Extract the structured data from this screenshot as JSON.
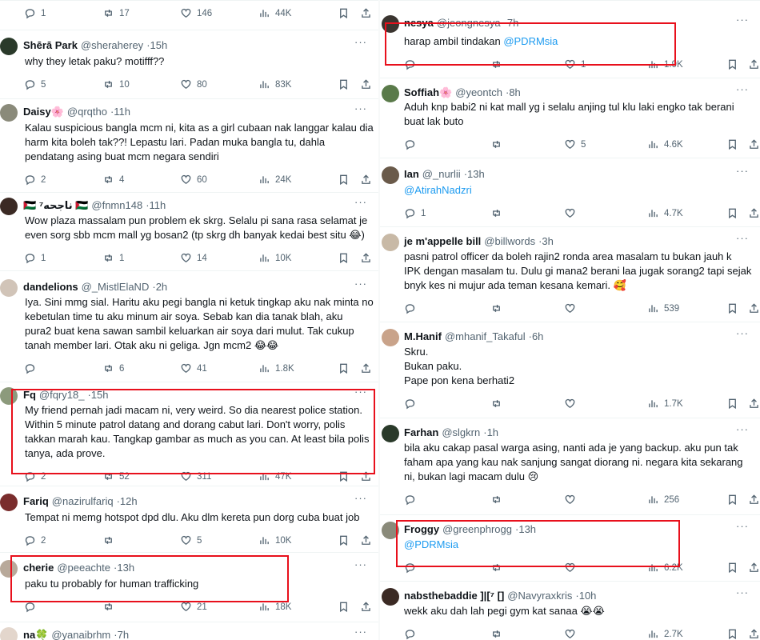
{
  "left": [
    {
      "name": "",
      "handle": "",
      "time": "",
      "lines": [],
      "replies": "1",
      "reposts": "17",
      "likes": "146",
      "views": "44K"
    },
    {
      "name": "Shērā Park",
      "handle": "@sheraherey",
      "time": "15h",
      "lines": [
        "why they letak paku? motifff??"
      ],
      "replies": "5",
      "reposts": "10",
      "likes": "80",
      "views": "83K"
    },
    {
      "name": "Daisy🌸",
      "handle": "@qrqtho",
      "time": "11h",
      "lines": [
        "Kalau suspicious bangla mcm ni, kita as a girl cubaan nak langgar kalau dia",
        "harm kita boleh tak??! Lepastu lari. Padan muka bangla tu, dahla",
        "pendatang asing buat mcm negara sendiri"
      ],
      "replies": "2",
      "reposts": "4",
      "likes": "60",
      "views": "24K"
    },
    {
      "name": "🇵🇸 ناجحه⁷ 🇵🇸",
      "handle": "@fnmn148",
      "time": "11h",
      "lines": [
        "Wow plaza massalam pun problem ek skrg. Selalu pi sana rasa selamat je",
        "even sorg sbb mcm mall yg bosan2 (tp skrg dh banyak kedai best situ 😂)"
      ],
      "replies": "1",
      "reposts": "1",
      "likes": "14",
      "views": "10K"
    },
    {
      "name": "dandelions",
      "handle": "@_MistlElaND",
      "time": "2h",
      "lines": [
        "Iya. Sini mmg sial. Haritu aku pegi bangla ni ketuk tingkap aku nak minta no",
        "kebetulan time tu aku minum air soya. Sebab kan dia tanak blah, aku",
        "pura2 buat kena sawan sambil keluarkan air soya dari mulut. Tak cukup",
        "tanah member lari. Otak aku ni geliga. Jgn mcm2 😂😂"
      ],
      "replies": "",
      "reposts": "6",
      "likes": "41",
      "views": "1.8K"
    },
    {
      "name": "Fq",
      "handle": "@fqry18_",
      "time": "15h",
      "lines": [
        "My friend pernah jadi macam ni, very weird. So dia nearest police station.",
        "Within 5 minute patrol datang and dorang cabut lari.  Don't worry, polis",
        "takkan marah kau. Tangkap gambar as much as you can. At least bila polis",
        "tanya, ada prove."
      ],
      "replies": "2",
      "reposts": "52",
      "likes": "311",
      "views": "47K"
    },
    {
      "name": "Fariq",
      "handle": "@nazirulfariq",
      "time": "12h",
      "lines": [
        "Tempat ni memg hotspot dpd dlu. Aku dlm kereta pun dorg cuba buat job"
      ],
      "replies": "2",
      "reposts": "",
      "likes": "5",
      "views": "10K"
    },
    {
      "name": "cherie",
      "handle": "@peeachte",
      "time": "13h",
      "lines": [
        "paku tu probably for human trafficking"
      ],
      "replies": "",
      "reposts": "",
      "likes": "21",
      "views": "18K"
    },
    {
      "name": "na🍀",
      "handle": "@yanaibrhm",
      "time": "7h",
      "lines": [],
      "replies": "",
      "reposts": "",
      "likes": "",
      "views": ""
    }
  ],
  "right": [
    {
      "name": "nesya",
      "handle": "@jeongnesya",
      "time": "7h",
      "lines": [
        "harap ambil tindakan @PDRMsia"
      ],
      "replies": "",
      "reposts": "",
      "likes": "1",
      "views": "1.9K"
    },
    {
      "name": "Soffiah🌸",
      "handle": "@yeontch",
      "time": "8h",
      "lines": [
        "Aduh knp babi2 ni kat mall yg i selalu anjing tul klu laki engko tak berani",
        "buat lak buto"
      ],
      "replies": "",
      "reposts": "",
      "likes": "5",
      "views": "4.6K"
    },
    {
      "name": "Ian",
      "handle": "@_nurlii",
      "time": "13h",
      "lines": [
        "@AtirahNadzri"
      ],
      "replies": "1",
      "reposts": "",
      "likes": "",
      "views": "4.7K"
    },
    {
      "name": "je m'appelle bill",
      "handle": "@billwords",
      "time": "3h",
      "lines": [
        "pasni patrol officer da boleh rajin2 ronda area masalam tu bukan jauh k",
        "IPK dengan masalam tu. Dulu gi mana2 berani laa jugak sorang2 tapi sejak",
        "bnyk kes ni mujur ada teman kesana kemari. 🥰"
      ],
      "replies": "",
      "reposts": "",
      "likes": "",
      "views": "539"
    },
    {
      "name": "M.Hanif",
      "handle": "@mhanif_Takaful",
      "time": "6h",
      "lines": [
        "Skru.",
        "Bukan paku.",
        "Pape pon kena berhati2"
      ],
      "replies": "",
      "reposts": "",
      "likes": "",
      "views": "1.7K"
    },
    {
      "name": "Farhan",
      "handle": "@slgkrn",
      "time": "1h",
      "lines": [
        "bila aku cakap pasal warga asing, nanti ada je yang backup. aku pun tak",
        "faham apa yang kau nak sanjung sangat diorang ni. negara kita sekarang",
        "ni, bukan lagi macam dulu 😢"
      ],
      "replies": "",
      "reposts": "",
      "likes": "",
      "views": "256"
    },
    {
      "name": "Froggy",
      "handle": "@greenphrogg",
      "time": "13h",
      "lines": [
        "@PDRMsia"
      ],
      "replies": "",
      "reposts": "",
      "likes": "",
      "views": "6.2K"
    },
    {
      "name": "nabsthebaddie ]|[⁷ []",
      "handle": "@Navyraxkris",
      "time": "10h",
      "lines": [
        "wekk aku dah lah pegi gym kat sanaa 😭😭"
      ],
      "replies": "",
      "reposts": "",
      "likes": "",
      "views": "2.7K"
    }
  ],
  "colors": {
    "accent": "#1d9bf0",
    "highlight": "#e8101c",
    "muted": "#536471"
  }
}
